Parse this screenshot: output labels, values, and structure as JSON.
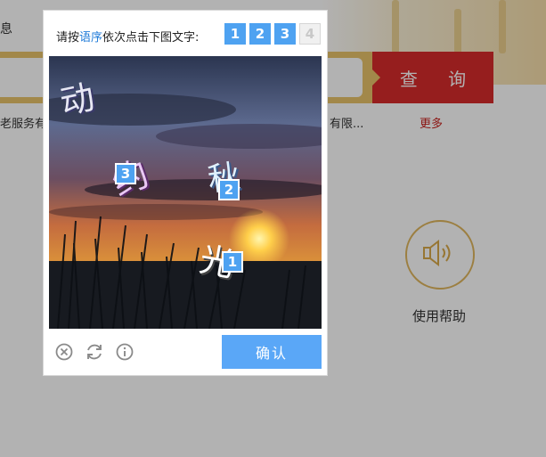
{
  "background_page": {
    "top_left_text": "息",
    "query_button_label": "查 询",
    "result_left_text": "老服务有",
    "result_right_text": "有限...",
    "more_link_label": "更多",
    "help_label": "使用帮助",
    "help_icon": "speaker-icon",
    "colors": {
      "query_button": "#d72c2c",
      "search_border": "#e8c36b",
      "help_ring": "#e0b65e",
      "more_link": "#c9211e"
    }
  },
  "captcha": {
    "instruction_prefix": "请按",
    "instruction_highlight": "语序",
    "instruction_suffix": "依次点击下图文字:",
    "order_chips": [
      {
        "label": "1",
        "state": "selected"
      },
      {
        "label": "2",
        "state": "selected"
      },
      {
        "label": "3",
        "state": "selected"
      },
      {
        "label": "4",
        "state": "pending"
      }
    ],
    "image_glyphs": [
      {
        "text": "动"
      },
      {
        "text": "秋"
      },
      {
        "text": "光"
      },
      {
        "text": "约"
      }
    ],
    "click_markers": [
      {
        "label": "1"
      },
      {
        "label": "2"
      },
      {
        "label": "3"
      }
    ],
    "footer": {
      "close_icon": "close-circle-icon",
      "refresh_icon": "refresh-icon",
      "info_icon": "info-icon",
      "confirm_label": "确认"
    },
    "colors": {
      "accent": "#4ea2f1",
      "highlight_text": "#1f7bd8",
      "confirm_button": "#5aa7f7"
    }
  }
}
